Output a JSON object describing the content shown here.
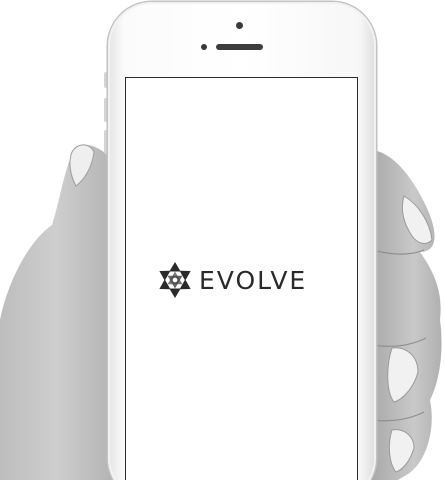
{
  "app": {
    "brand_name": "EVOLVE",
    "logo_icon": "evolve-star-logo"
  },
  "colors": {
    "logo_text": "#2a2a2a",
    "screen_background": "#ffffff"
  }
}
